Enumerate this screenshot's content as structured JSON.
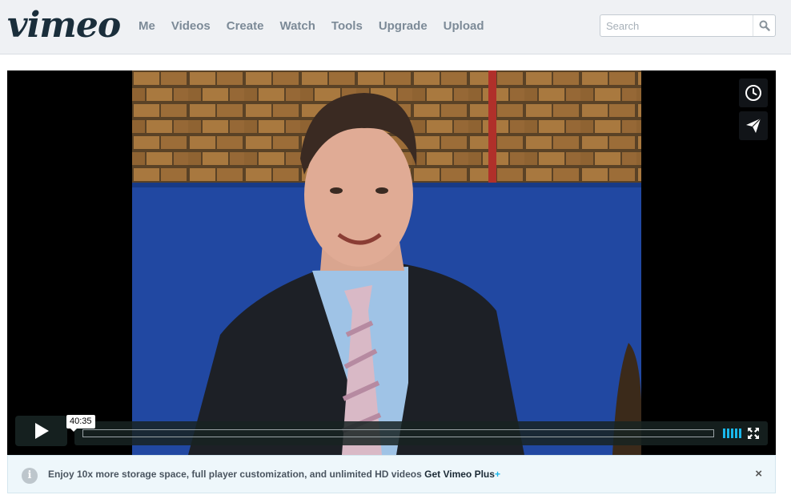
{
  "brand": {
    "logo_text": "vimeo"
  },
  "nav": {
    "items": [
      {
        "label": "Me"
      },
      {
        "label": "Videos"
      },
      {
        "label": "Create"
      },
      {
        "label": "Watch"
      },
      {
        "label": "Tools"
      },
      {
        "label": "Upgrade"
      },
      {
        "label": "Upload"
      }
    ]
  },
  "search": {
    "placeholder": "Search",
    "value": "",
    "icon": "search-icon"
  },
  "player": {
    "side_buttons": [
      {
        "icon": "clock-icon"
      },
      {
        "icon": "send-icon"
      }
    ],
    "play_icon": "play-icon",
    "time_tooltip": "40:35",
    "progress": 0.0,
    "hd_icon": "hd-bars-icon",
    "fullscreen_icon": "fullscreen-icon"
  },
  "banner": {
    "icon": "info-icon",
    "icon_glyph": "i",
    "text": "Enjoy 10x more storage space, full player customization, and unlimited HD videos ",
    "link_text": "Get Vimeo Plus",
    "plus_mark": "+",
    "close_glyph": "×"
  },
  "colors": {
    "accent": "#1ab7ea",
    "header_bg": "#eff1f4",
    "logo": "#1a2e3b",
    "nav_text": "#7c8a97",
    "banner_bg": "#eef7fb"
  }
}
